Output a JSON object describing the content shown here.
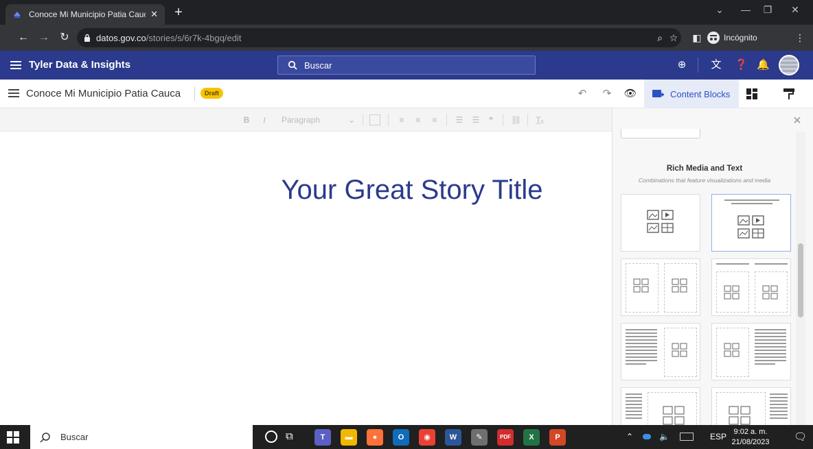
{
  "browser": {
    "tab_title": "Conoce Mi Municipio Patia Cauca",
    "tab_close": "✕",
    "new_tab": "+",
    "url_host": "datos.gov.co",
    "url_path": "/stories/s/6r7k-4bgq/edit",
    "incognito_label": "Incógnito"
  },
  "app": {
    "brand": "Tyler Data & Insights",
    "search_placeholder": "Buscar"
  },
  "story": {
    "title": "Conoce Mi Municipio Patia Cauca",
    "status_badge": "Draft",
    "content_blocks_label": "Content Blocks",
    "headline": "Your Great Story Title"
  },
  "editor_toolbar": {
    "bold": "B",
    "italic": "I",
    "block_format": "Paragraph",
    "quote": "❝",
    "clear": "T̲ₓ"
  },
  "panel": {
    "section_title": "Rich Media and Text",
    "section_subtitle": "Combinations that feature visualizations and media",
    "close": "✕"
  },
  "taskbar": {
    "search_placeholder": "Buscar",
    "language": "ESP",
    "time": "9:02 a. m.",
    "date": "21/08/2023",
    "apps": [
      {
        "name": "Teams",
        "glyph": "T",
        "color": "#5b5fc7"
      },
      {
        "name": "Explorer",
        "glyph": "▬",
        "color": "#f2b800"
      },
      {
        "name": "Firefox",
        "glyph": "●",
        "color": "#ff7139"
      },
      {
        "name": "Outlook",
        "glyph": "O",
        "color": "#0f6cbd"
      },
      {
        "name": "Chrome",
        "glyph": "◉",
        "color": "#e94235"
      },
      {
        "name": "Word",
        "glyph": "W",
        "color": "#2b579a"
      },
      {
        "name": "Paint",
        "glyph": "✎",
        "color": "#6f6f6f"
      },
      {
        "name": "PDF",
        "glyph": "PDF",
        "color": "#d12d2d"
      },
      {
        "name": "Excel",
        "glyph": "X",
        "color": "#217346"
      },
      {
        "name": "PowerPoint",
        "glyph": "P",
        "color": "#d24726"
      }
    ]
  }
}
